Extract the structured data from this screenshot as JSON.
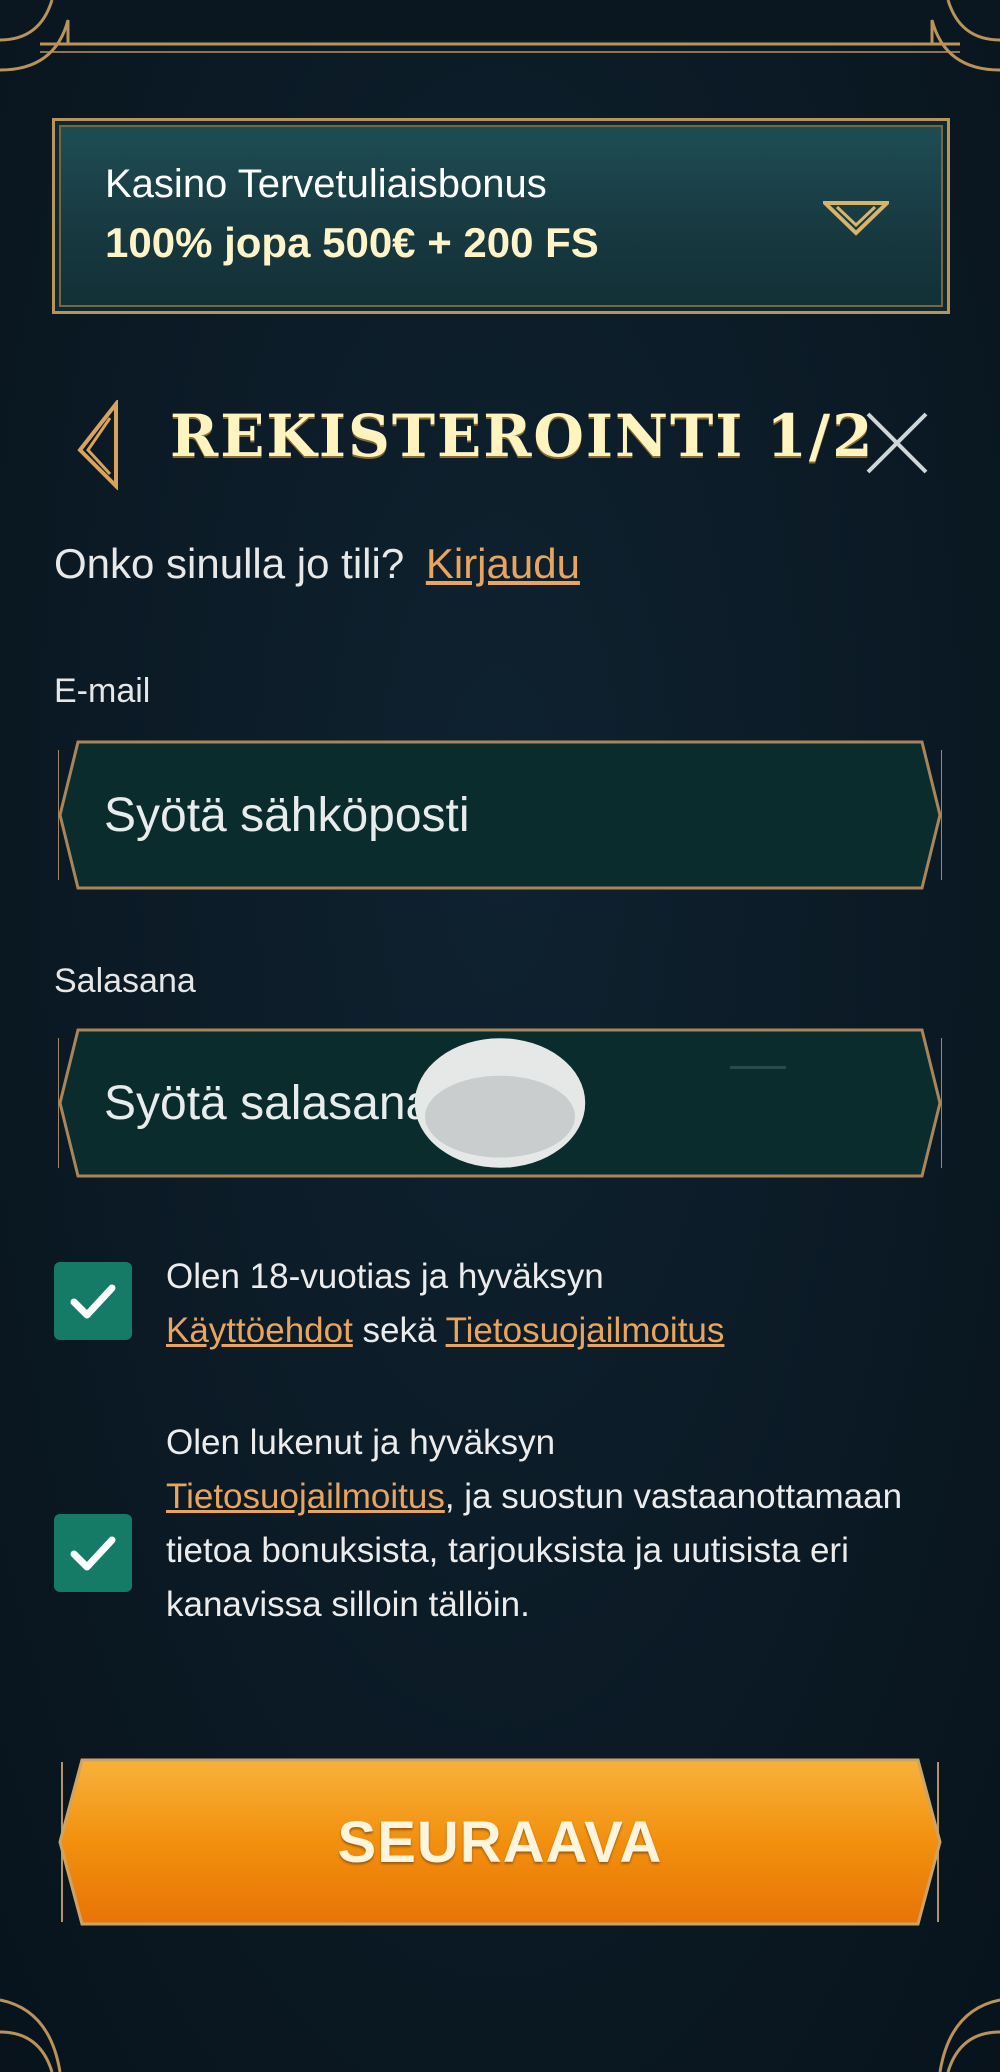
{
  "bonus": {
    "title": "Kasino Tervetuliaisbonus",
    "offer": "100% jopa 500€ + 200 FS",
    "chevron_icon": "chevron-down-icon"
  },
  "header": {
    "title": "REKISTEROINTI 1/2",
    "back_icon": "chevron-left-icon",
    "close_icon": "close-icon"
  },
  "login": {
    "prompt": "Onko sinulla jo tili?",
    "link": "Kirjaudu"
  },
  "email": {
    "label": "E-mail",
    "placeholder": "Syötä sähköposti",
    "value": ""
  },
  "password": {
    "label": "Salasana",
    "placeholder": "Syötä salasana",
    "value": "",
    "toggle_icon": "eye-icon"
  },
  "consent_age": {
    "checked": true,
    "text_before": "Olen 18-vuotias ja hyväksyn",
    "terms_link": "Käyttöehdot",
    "joiner": "sekä",
    "privacy_link": "Tietosuojailmoitus"
  },
  "consent_marketing": {
    "checked": true,
    "text_before": "Olen lukenut ja hyväksyn",
    "privacy_link": "Tietosuojailmoitus",
    "text_after": ", ja suostun vastaanottamaan tietoa bonuksista, tarjouksista ja uutisista eri kanavissa silloin tällöin."
  },
  "actions": {
    "next_label": "SEURAAVA"
  },
  "colors": {
    "background": "#0b1a26",
    "gold": "#b8935a",
    "accent_link": "#e9a55e",
    "checkbox": "#157a66",
    "button": "#f08a10"
  }
}
